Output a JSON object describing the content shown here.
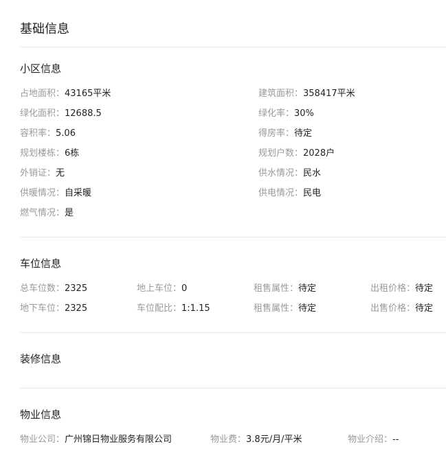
{
  "title": "基础信息",
  "community": {
    "title": "小区信息",
    "items": [
      {
        "label": "占地面积：",
        "value": "43165平米"
      },
      {
        "label": "建筑面积：",
        "value": "358417平米"
      },
      {
        "label": "绿化面积：",
        "value": "12688.5"
      },
      {
        "label": "绿化率：",
        "value": "30%"
      },
      {
        "label": "容积率：",
        "value": "5.06"
      },
      {
        "label": "得房率：",
        "value": "待定"
      },
      {
        "label": "规划楼栋：",
        "value": "6栋"
      },
      {
        "label": "规划户数：",
        "value": "2028户"
      },
      {
        "label": "外销证：",
        "value": "无"
      },
      {
        "label": "供水情况：",
        "value": "民水"
      },
      {
        "label": "供暖情况：",
        "value": "自采暖"
      },
      {
        "label": "供电情况：",
        "value": "民电"
      },
      {
        "label": "燃气情况：",
        "value": "是"
      }
    ]
  },
  "parking": {
    "title": "车位信息",
    "items": [
      {
        "label": "总车位数：",
        "value": "2325"
      },
      {
        "label": "地上车位：",
        "value": "0"
      },
      {
        "label": "租售属性：",
        "value": "待定"
      },
      {
        "label": "出租价格：",
        "value": "待定"
      },
      {
        "label": "地下车位：",
        "value": "2325"
      },
      {
        "label": "车位配比：",
        "value": "1:1.15"
      },
      {
        "label": "租售属性：",
        "value": "待定"
      },
      {
        "label": "出售价格：",
        "value": "待定"
      }
    ]
  },
  "decoration": {
    "title": "装修信息"
  },
  "property": {
    "title": "物业信息",
    "items": [
      {
        "label": "物业公司：",
        "value": "广州锦日物业服务有限公司"
      },
      {
        "label": "物业费：",
        "value": "3.8元/月/平米"
      },
      {
        "label": "物业介绍：",
        "value": "--"
      }
    ]
  }
}
